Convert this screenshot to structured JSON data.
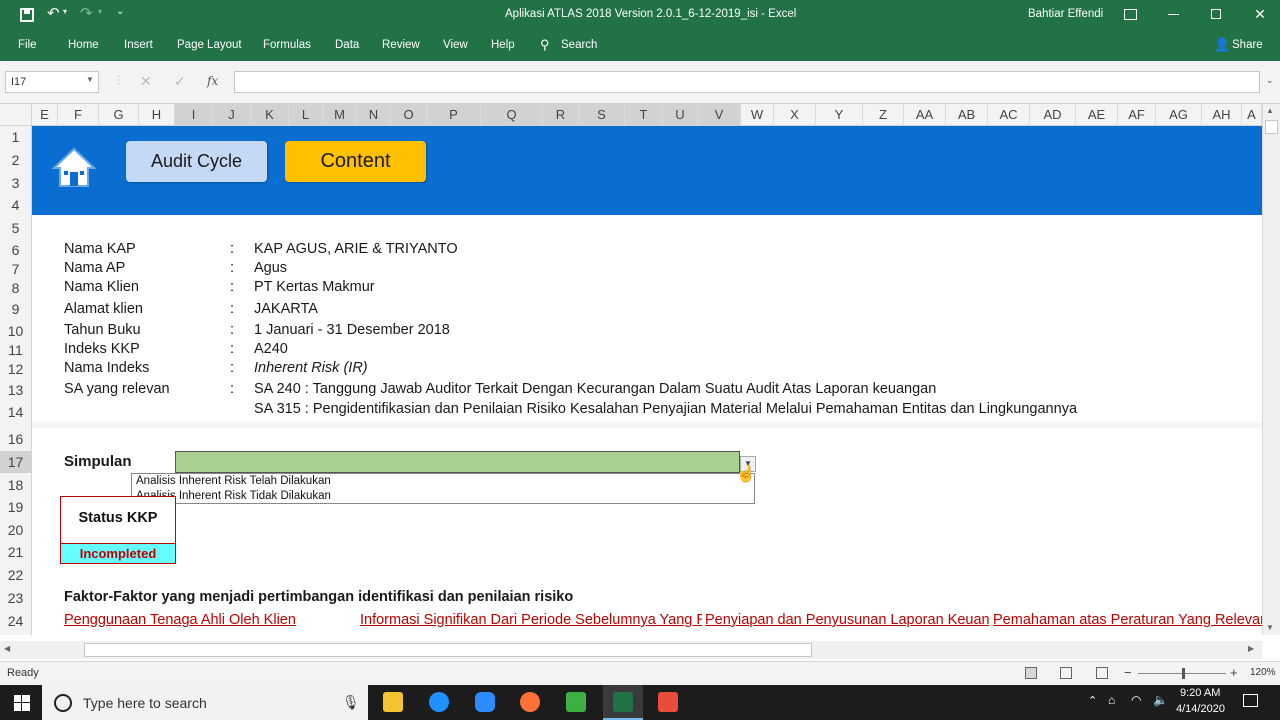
{
  "window": {
    "title": "Aplikasi ATLAS 2018 Version 2.0.1_6-12-2019_isi  -  Excel",
    "user": "Bahtiar Effendi"
  },
  "ribbon": {
    "tabs": [
      "File",
      "Home",
      "Insert",
      "Page Layout",
      "Formulas",
      "Data",
      "Review",
      "View",
      "Help"
    ],
    "search_label": "Search",
    "share_label": "Share"
  },
  "formula_bar": {
    "name_box": "I17",
    "fx_label": "fx",
    "content": ""
  },
  "columns": [
    "E",
    "F",
    "G",
    "H",
    "I",
    "J",
    "K",
    "L",
    "M",
    "N",
    "O",
    "P",
    "Q",
    "R",
    "S",
    "T",
    "U",
    "V",
    "W",
    "X",
    "Y",
    "Z",
    "AA",
    "AB",
    "AC",
    "AD",
    "AE",
    "AF",
    "AG",
    "AH",
    "A"
  ],
  "rows": [
    "1",
    "2",
    "3",
    "4",
    "5",
    "6",
    "7",
    "8",
    "9",
    "10",
    "11",
    "12",
    "13",
    "14",
    "16",
    "17",
    "18",
    "19",
    "20",
    "21",
    "22",
    "23",
    "24"
  ],
  "buttons": {
    "audit_cycle": "Audit Cycle",
    "content": "Content"
  },
  "info": [
    {
      "label": "Nama KAP",
      "value": "KAP AGUS, ARIE & TRIYANTO"
    },
    {
      "label": "Nama AP",
      "value": "Agus"
    },
    {
      "label": "Nama Klien",
      "value": "PT Kertas Makmur"
    },
    {
      "label": "Alamat klien",
      "value": "JAKARTA"
    },
    {
      "label": "Tahun Buku",
      "value": "1 Januari - 31 Desember 2018"
    },
    {
      "label": "Indeks KKP",
      "value": "A240"
    },
    {
      "label": "Nama Indeks",
      "value": "Inherent Risk (IR)"
    },
    {
      "label": "SA yang relevan",
      "value": "SA 240 : Tanggung Jawab Auditor Terkait Dengan Kecurangan Dalam Suatu Audit Atas Laporan keuangan"
    }
  ],
  "info_extra_line": "SA 315 : Pengidentifikasian dan Penilaian Risiko Kesalahan Penyajian Material Melalui Pemahaman Entitas dan Lingkungannya",
  "colon": ":",
  "simpulan": {
    "label": "Simpulan",
    "options": [
      "Analisis Inherent Risk Telah Dilakukan",
      "Analisis Inherent Risk Tidak Dilakukan"
    ]
  },
  "status": {
    "label": "Status KKP",
    "value": "Incompleted"
  },
  "faktor_heading": "Faktor-Faktor yang menjadi pertimbangan identifikasi dan penilaian risiko",
  "links": [
    "Penggunaan Tenaga Ahli Oleh Klien",
    "Informasi  Signifikan Dari Periode Sebelumnya Yang Relevan",
    "Penyiapan dan Penyusunan Laporan Keuangan",
    "Pemahaman atas Peraturan Yang Relevan"
  ],
  "statusbar": {
    "ready": "Ready",
    "zoom": "120%"
  },
  "taskbar": {
    "search_placeholder": "Type here to search",
    "time": "9:20 AM",
    "date": "4/14/2020"
  },
  "colors": {
    "excel_green": "#217346",
    "banner_blue": "#0a6ed1",
    "content_yellow": "#ffc000",
    "audit_light_blue": "#c3d9f5",
    "link_red": "#c00000",
    "simpulan_green": "#a9d08e",
    "status_cyan": "#66ffff"
  }
}
